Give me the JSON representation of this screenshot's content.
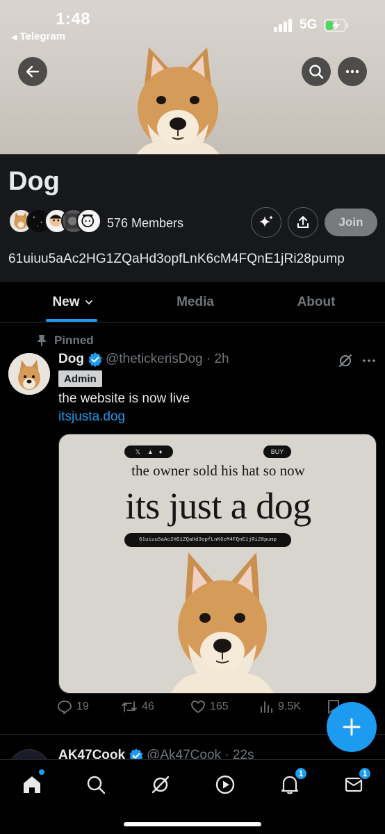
{
  "status_bar": {
    "time": "1:48",
    "back_app": "Telegram",
    "network": "5G"
  },
  "community": {
    "name": "Dog",
    "members": "576 Members",
    "join_label": "Join",
    "contract": "61uiuu5aAc2HG1ZQaHd3opfLnK6cM4FQnE1jRi28pump"
  },
  "tabs": [
    {
      "label": "New"
    },
    {
      "label": "Media"
    },
    {
      "label": "About"
    }
  ],
  "post": {
    "pinned_label": "Pinned",
    "name": "Dog",
    "handle_time": "@thetickerisDog · 2h",
    "badge": "Admin",
    "text": "the website is now live",
    "link": "itsjusta.dog",
    "media": {
      "buy_label": "BUY",
      "line1": "the owner sold his hat so now",
      "line2": "its just a dog",
      "contract": "61uiuu5aAc2HG1ZQaHd3opfLnK6cM4FQnE1jRi28pump"
    },
    "stats": {
      "replies": "19",
      "reposts": "46",
      "likes": "165",
      "views": "9.5K"
    }
  },
  "next_post": {
    "name": "AK47Cook",
    "handle_time": "@Ak47Cook · 22s"
  },
  "nav": {
    "notifications_badge": "1",
    "messages_badge": "1"
  },
  "colors": {
    "accent": "#1d9bf0",
    "background": "#000000",
    "surface": "#16181c",
    "muted_text": "#71767b"
  }
}
